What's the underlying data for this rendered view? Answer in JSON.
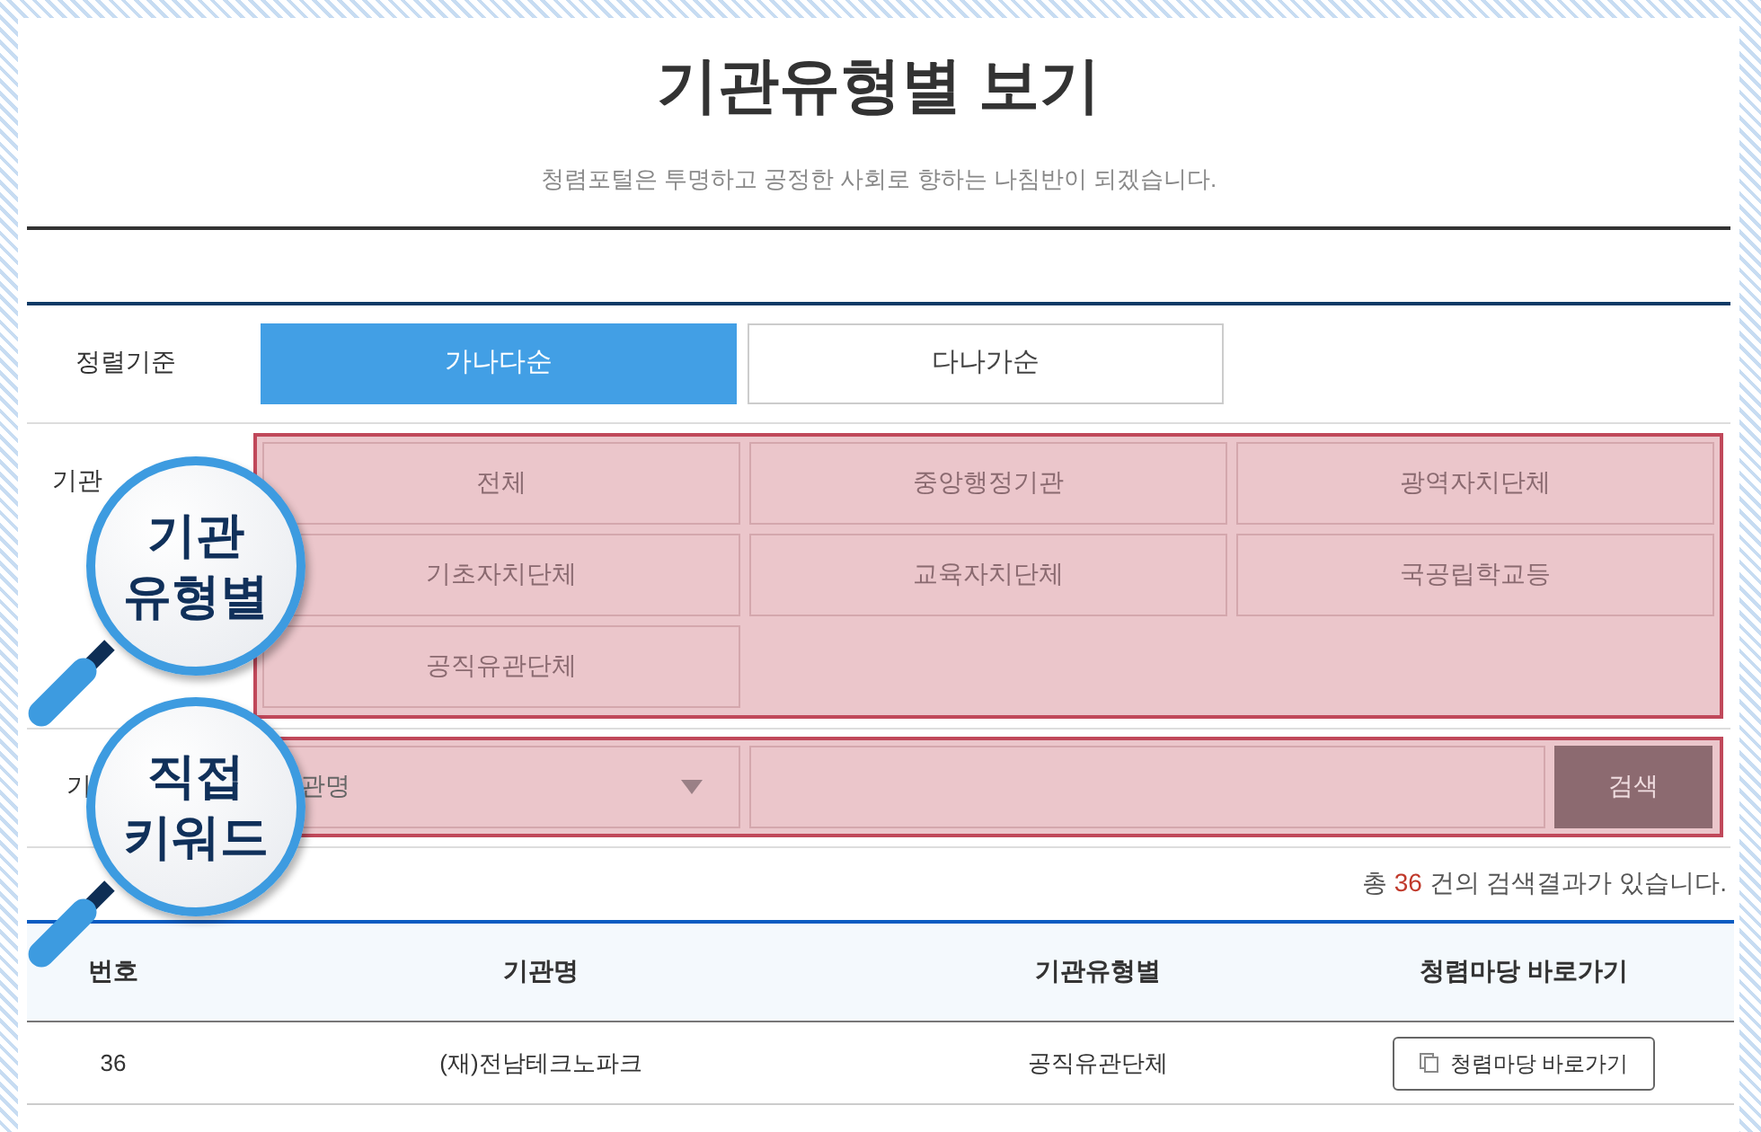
{
  "title": "기관유형별 보기",
  "subtitle": "청렴포털은 투명하고 공정한 사회로 향하는 나침반이 되겠습니다.",
  "sort": {
    "label": "정렬기준",
    "options": [
      {
        "label": "가나다순",
        "selected": true
      },
      {
        "label": "다나가순",
        "selected": false
      }
    ]
  },
  "type_filter": {
    "label": "기관",
    "options": [
      {
        "label": "전체",
        "selected": false
      },
      {
        "label": "중앙행정기관",
        "selected": false
      },
      {
        "label": "광역자치단체",
        "selected": false
      },
      {
        "label": "기초자치단체",
        "selected": false
      },
      {
        "label": "교육자치단체",
        "selected": false
      },
      {
        "label": "국공립학교등",
        "selected": false
      },
      {
        "label": "공직유관단체",
        "selected": false
      }
    ]
  },
  "keyword": {
    "label": "기",
    "select_value": "관명",
    "button": "검색"
  },
  "result": {
    "prefix": "총",
    "count": "36",
    "suffix": "건의 검색결과가 있습니다."
  },
  "table": {
    "columns": [
      "번호",
      "기관명",
      "기관유형별",
      "청렴마당 바로가기"
    ],
    "rows": [
      {
        "cells": [
          "36",
          "(재)전남테크노파크",
          "공직유관단체"
        ],
        "link": "청렴마당 바로가기"
      }
    ]
  },
  "callouts": [
    {
      "lines": [
        "기관",
        "유형별"
      ]
    },
    {
      "lines": [
        "직접",
        "키워드"
      ]
    }
  ]
}
